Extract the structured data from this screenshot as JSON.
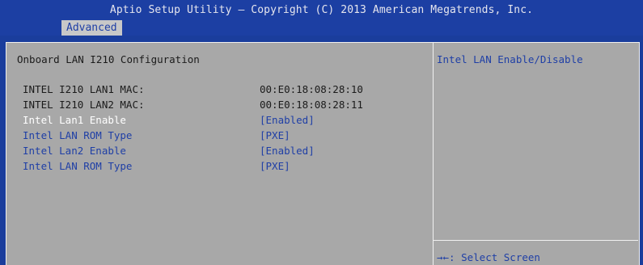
{
  "header": {
    "title": "Aptio Setup Utility – Copyright (C) 2013 American Megatrends, Inc.",
    "tab": "Advanced"
  },
  "main": {
    "section_title": "Onboard LAN I210 Configuration",
    "info_rows": [
      {
        "label": "INTEL I210 LAN1 MAC:",
        "value": "00:E0:18:08:28:10"
      },
      {
        "label": "INTEL I210 LAN2 MAC:",
        "value": "00:E0:18:08:28:11"
      }
    ],
    "options": [
      {
        "label": "Intel Lan1 Enable",
        "value": "[Enabled]"
      },
      {
        "label": "Intel LAN ROM Type",
        "value": "[PXE]"
      },
      {
        "label": "Intel Lan2 Enable",
        "value": "[Enabled]"
      },
      {
        "label": "Intel LAN ROM Type",
        "value": "[PXE]"
      }
    ]
  },
  "help": {
    "text": "Intel LAN Enable/Disable",
    "keys": "→←: Select Screen"
  },
  "colors": {
    "background": "#1a3d9c",
    "panel": "#a8a8a8",
    "selected_text": "#ffffff",
    "option_text": "#1f3fa6"
  }
}
